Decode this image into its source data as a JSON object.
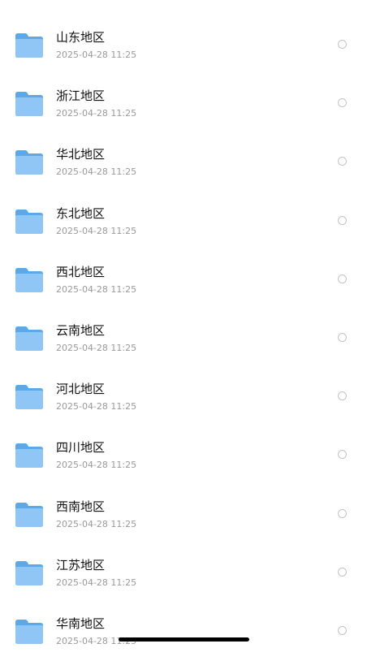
{
  "files": [
    {
      "name": "山东地区",
      "date": "2025-04-28 11:25",
      "icon": "folder-icon"
    },
    {
      "name": "浙江地区",
      "date": "2025-04-28 11:25",
      "icon": "folder-icon"
    },
    {
      "name": "华北地区",
      "date": "2025-04-28 11:25",
      "icon": "folder-icon"
    },
    {
      "name": "东北地区",
      "date": "2025-04-28 11:25",
      "icon": "folder-icon"
    },
    {
      "name": "西北地区",
      "date": "2025-04-28 11:25",
      "icon": "folder-icon"
    },
    {
      "name": "云南地区",
      "date": "2025-04-28 11:25",
      "icon": "folder-icon"
    },
    {
      "name": "河北地区",
      "date": "2025-04-28 11:25",
      "icon": "folder-icon"
    },
    {
      "name": "四川地区",
      "date": "2025-04-28 11:25",
      "icon": "folder-icon"
    },
    {
      "name": "西南地区",
      "date": "2025-04-28 11:25",
      "icon": "folder-icon"
    },
    {
      "name": "江苏地区",
      "date": "2025-04-28 11:25",
      "icon": "folder-icon"
    },
    {
      "name": "华南地区",
      "date": "2025-04-28 11:25",
      "icon": "folder-icon"
    }
  ],
  "colors": {
    "folder_back": "#5aa9ea",
    "folder_front": "#8fc6f6",
    "radio_border": "#c4c4c4",
    "date_text": "#9a9a9a"
  }
}
